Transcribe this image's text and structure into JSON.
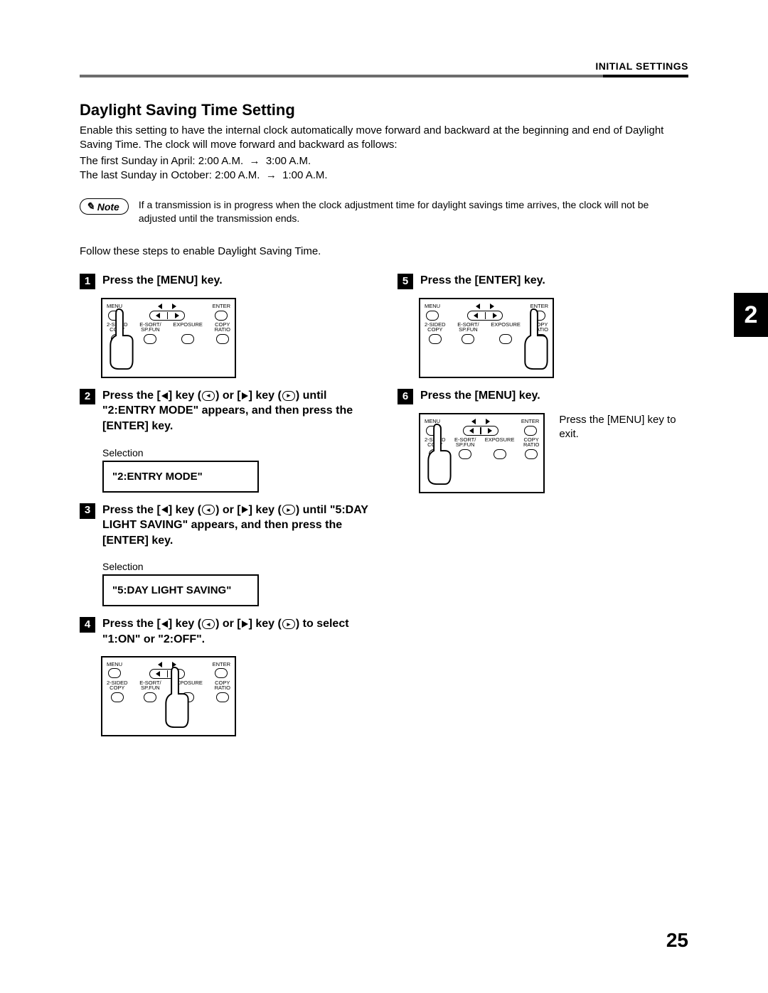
{
  "header": {
    "section": "INITIAL SETTINGS"
  },
  "title": "Daylight Saving Time Setting",
  "intro": {
    "lead": "Enable this setting to have the internal clock automatically move forward and backward at the beginning and end of Daylight Saving Time. The clock will move forward and backward as follows:",
    "line1_pre": "The first Sunday in April: 2:00 A.M.",
    "line1_post": "3:00 A.M.",
    "line2_pre": "The last Sunday in October: 2:00 A.M.",
    "line2_post": "1:00 A.M."
  },
  "note": {
    "label": "Note",
    "text": "If a transmission is in progress when the clock adjustment time for daylight savings time arrives, the clock will not be adjusted until the transmission ends."
  },
  "follow": "Follow these steps to enable Daylight Saving Time.",
  "panel_labels": {
    "menu": "MENU",
    "enter": "ENTER",
    "l1": "2-SIDED",
    "l1b": "COPY",
    "l2": "E-SORT/",
    "l2b": "SP.FUN",
    "l3": "EXPOSURE",
    "l4": "COPY",
    "l4b": "RATIO"
  },
  "steps": {
    "s1": {
      "num": "1",
      "title": "Press the [MENU] key."
    },
    "s2": {
      "num": "2",
      "t_a": "Press the [",
      "t_b": "] key (",
      "t_c": ") or [",
      "t_d": "] key (",
      "t_e": ")",
      "t_line2": "until \"2:ENTRY MODE\" appears, and then press the [ENTER] key.",
      "selection": "Selection",
      "lcd": "\"2:ENTRY MODE\""
    },
    "s3": {
      "num": "3",
      "t_a": "Press the [",
      "t_b": "] key (",
      "t_c": ") or [",
      "t_d": "] key (",
      "t_e": ")",
      "t_line2": "until \"5:DAY LIGHT SAVING\" appears, and then press the [ENTER] key.",
      "selection": "Selection",
      "lcd": "\"5:DAY LIGHT SAVING\""
    },
    "s4": {
      "num": "4",
      "t_a": "Press the [",
      "t_b": "] key (",
      "t_c": ") or [",
      "t_d": "] key (",
      "t_e": ")",
      "t_line2": "to select \"1:ON\" or \"2:OFF\"."
    },
    "s5": {
      "num": "5",
      "title": "Press the [ENTER] key."
    },
    "s6": {
      "num": "6",
      "title": "Press the [MENU] key.",
      "aside": "Press the [MENU] key to exit."
    }
  },
  "chapter": "2",
  "page_number": "25"
}
